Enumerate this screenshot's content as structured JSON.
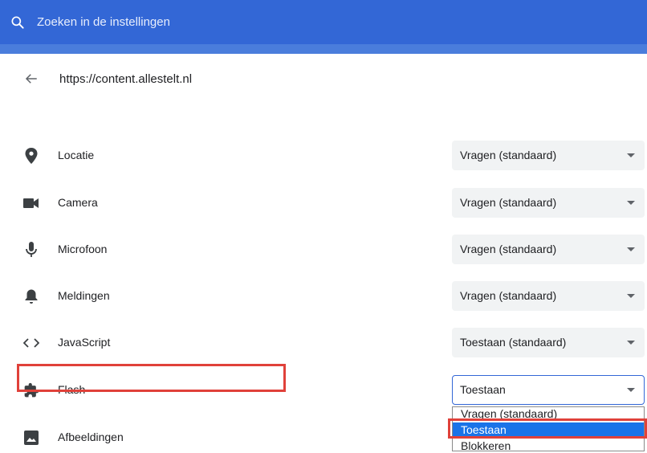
{
  "search": {
    "placeholder": "Zoeken in de instellingen"
  },
  "site": {
    "url": "https://content.allestelt.nl"
  },
  "permissions": [
    {
      "label": "Locatie",
      "icon": "location-pin-icon",
      "value": "Vragen (standaard)"
    },
    {
      "label": "Camera",
      "icon": "camera-icon",
      "value": "Vragen (standaard)"
    },
    {
      "label": "Microfoon",
      "icon": "microphone-icon",
      "value": "Vragen (standaard)"
    },
    {
      "label": "Meldingen",
      "icon": "bell-icon",
      "value": "Vragen (standaard)"
    },
    {
      "label": "JavaScript",
      "icon": "code-icon",
      "value": "Toestaan (standaard)"
    },
    {
      "label": "Flash",
      "icon": "puzzle-icon",
      "value": "Toestaan"
    },
    {
      "label": "Afbeeldingen",
      "icon": "image-icon",
      "value": ""
    }
  ],
  "flash_dropdown": {
    "options": [
      "Vragen (standaard)",
      "Toestaan",
      "Blokkeren"
    ],
    "selected": "Toestaan"
  },
  "colors": {
    "header": "#3367d6",
    "highlight": "#e0413a",
    "selected_option": "#1a73e8"
  }
}
